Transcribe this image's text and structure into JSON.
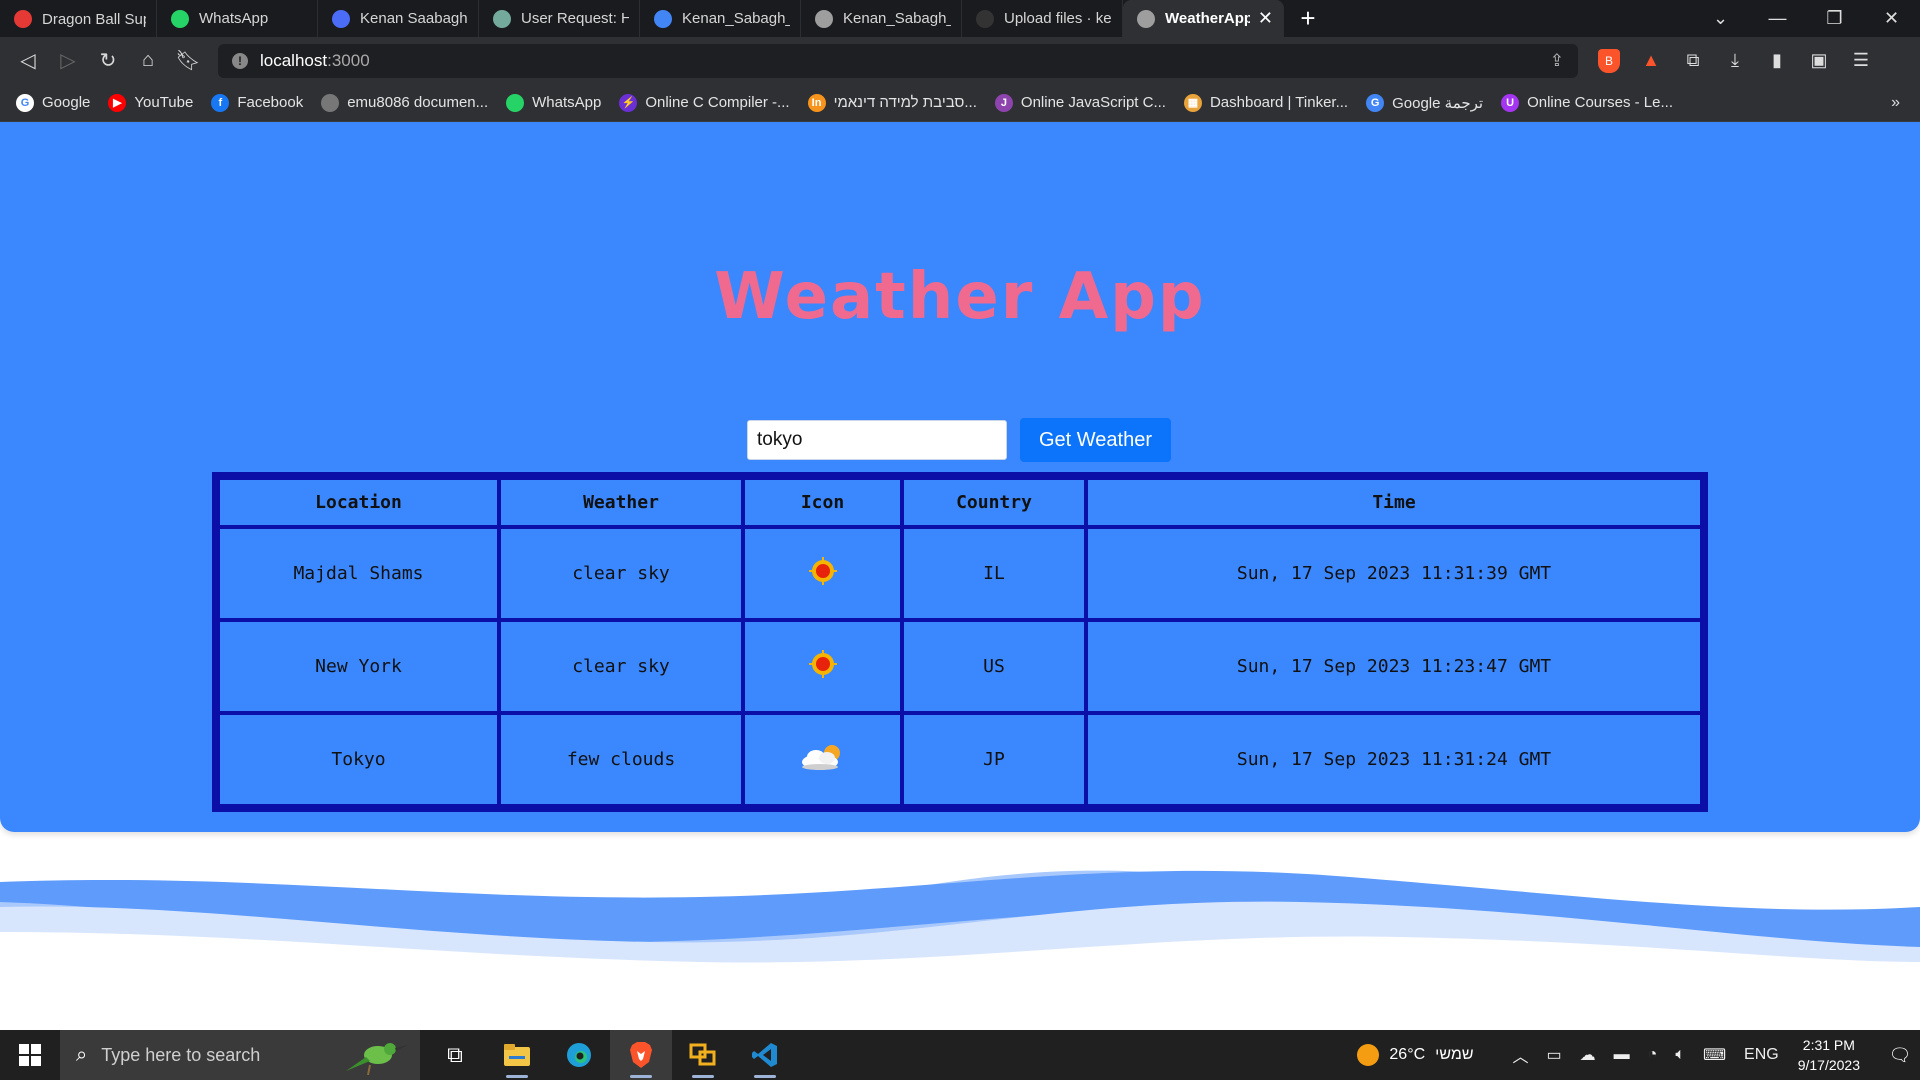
{
  "browser": {
    "tabs": [
      {
        "label": "Dragon Ball Super أنمي",
        "icon": "heart-icon",
        "color": "#e53935"
      },
      {
        "label": "WhatsApp",
        "icon": "whatsapp-icon",
        "color": "#25d366"
      },
      {
        "label": "Kenan Saabagh",
        "icon": "document-icon",
        "color": "#4a6cf7"
      },
      {
        "label": "User Request: Hi Assist",
        "icon": "chatgpt-icon",
        "color": "#74aa9c"
      },
      {
        "label": "Kenan_Sabagh_Resume",
        "icon": "docs-icon",
        "color": "#4285f4"
      },
      {
        "label": "Kenan_Sabagh_Resume",
        "icon": "globe-icon",
        "color": "#9e9e9e"
      },
      {
        "label": "Upload files · kenan-sa",
        "icon": "github-icon",
        "color": "#333333"
      },
      {
        "label": "WeatherApp",
        "icon": "globe-icon",
        "color": "#9e9e9e",
        "active": true
      }
    ],
    "url_host": "localhost",
    "url_port": ":3000"
  },
  "bookmarks": [
    {
      "label": "Google",
      "icon": "google-icon",
      "color": "#ffffff",
      "glyph": "G",
      "glyph_color": "#4285f4"
    },
    {
      "label": "YouTube",
      "icon": "youtube-icon",
      "color": "#ff0000",
      "glyph": "▶",
      "glyph_color": "#ffffff"
    },
    {
      "label": "Facebook",
      "icon": "facebook-icon",
      "color": "#1877f2",
      "glyph": "f",
      "glyph_color": "#ffffff"
    },
    {
      "label": "emu8086 documen...",
      "icon": "globe-icon",
      "color": "#777777",
      "glyph": "",
      "glyph_color": "#ffffff"
    },
    {
      "label": "WhatsApp",
      "icon": "whatsapp-icon",
      "color": "#25d366",
      "glyph": "",
      "glyph_color": "#ffffff"
    },
    {
      "label": "Online C Compiler -...",
      "icon": "lightning-icon",
      "color": "#6b2fd6",
      "glyph": "⚡",
      "glyph_color": "#ffffff"
    },
    {
      "label": "סביבת למידה דינאמי...",
      "icon": "learning-icon",
      "color": "#f7941d",
      "glyph": "In",
      "glyph_color": "#ffffff"
    },
    {
      "label": "Online JavaScript C...",
      "icon": "js-icon",
      "color": "#8e44ad",
      "glyph": "J",
      "glyph_color": "#ffffff"
    },
    {
      "label": "Dashboard | Tinker...",
      "icon": "tinkercad-icon",
      "color": "#e8a33a",
      "glyph": "▦",
      "glyph_color": "#ffffff"
    },
    {
      "label": "Google ترجمة",
      "icon": "translate-icon",
      "color": "#4285f4",
      "glyph": "G",
      "glyph_color": "#ffffff"
    },
    {
      "label": "Online Courses - Le...",
      "icon": "udemy-icon",
      "color": "#a435f0",
      "glyph": "U",
      "glyph_color": "#ffffff"
    }
  ],
  "app": {
    "title": "Weather App",
    "input_value": "tokyo",
    "button_label": "Get Weather",
    "headers": [
      "Location",
      "Weather",
      "Icon",
      "Country",
      "Time"
    ],
    "rows": [
      {
        "location": "Majdal Shams",
        "weather": "clear sky",
        "icon": "sun-icon",
        "country": "IL",
        "time": "Sun, 17 Sep 2023 11:31:39 GMT"
      },
      {
        "location": "New York",
        "weather": "clear sky",
        "icon": "sun-icon",
        "country": "US",
        "time": "Sun, 17 Sep 2023 11:23:47 GMT"
      },
      {
        "location": "Tokyo",
        "weather": "few clouds",
        "icon": "cloud-sun-icon",
        "country": "JP",
        "time": "Sun, 17 Sep 2023 11:31:24 GMT"
      }
    ],
    "colors": {
      "panel": "#3b87fd",
      "title": "#f06a8f",
      "table_border": "#0c0fa7",
      "button": "#0b74fa"
    }
  },
  "taskbar": {
    "search_placeholder": "Type here to search",
    "weather_temp": "26°C",
    "weather_day": "שמשי",
    "language": "ENG",
    "time": "2:31 PM",
    "date": "9/17/2023"
  }
}
